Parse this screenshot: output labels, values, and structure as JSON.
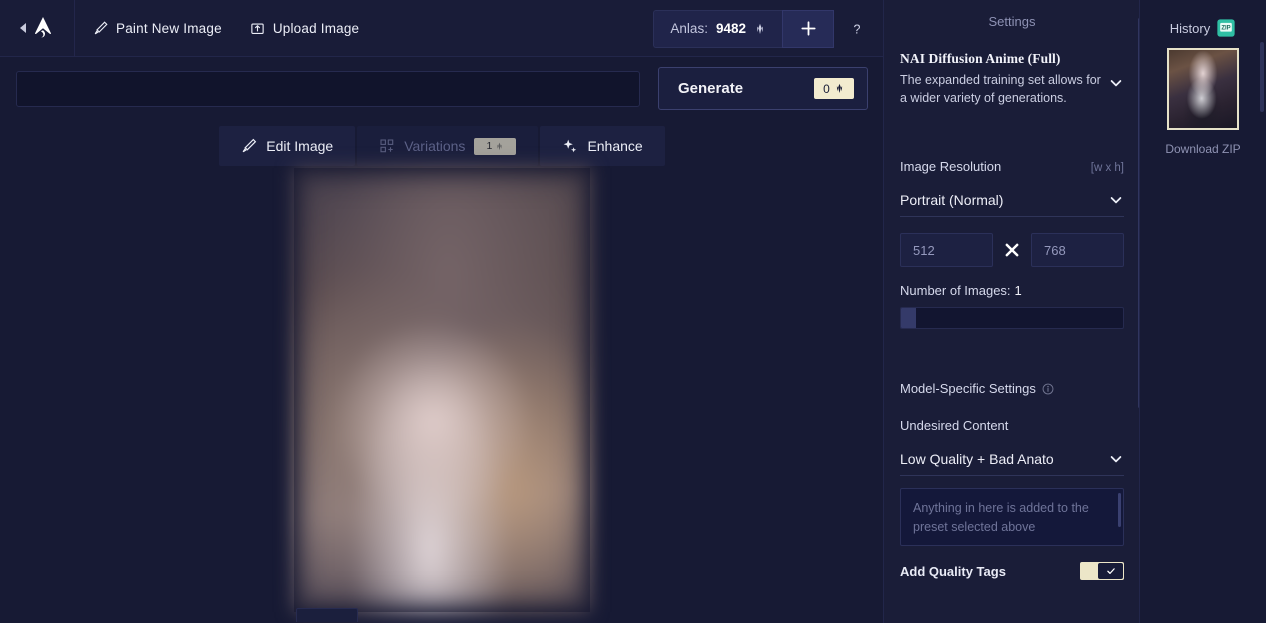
{
  "app": {
    "logo_icon": "novelai-leaf-logo",
    "collapse_icon": "collapse-left-arrow"
  },
  "toolbar": {
    "paint_new_image": "Paint New Image",
    "paint_icon": "paintbrush-icon",
    "upload_image": "Upload Image",
    "upload_icon": "upload-image-icon",
    "anlas_label": "Anlas:",
    "anlas_count": "9482",
    "anlas_icon": "anlas-icon",
    "add_icon": "plus-icon",
    "help_icon": "question-mark-icon"
  },
  "prompt": {
    "value": "",
    "placeholder": ""
  },
  "generate": {
    "label": "Generate",
    "cost": "0",
    "cost_icon": "anlas-icon"
  },
  "actions": [
    {
      "label": "Edit Image",
      "icon": "pencil-icon",
      "disabled": false,
      "badge": null
    },
    {
      "label": "Variations",
      "icon": "variations-grid-icon",
      "disabled": true,
      "badge": "1",
      "badge_icon": "anlas-icon"
    },
    {
      "label": "Enhance",
      "icon": "sparkle-icon",
      "disabled": false,
      "badge": null
    }
  ],
  "canvas": {
    "image_alt": "generated-image"
  },
  "settings": {
    "title": "Settings",
    "model": {
      "name": "NAI Diffusion Anime (Full)",
      "description": "The expanded training set allows for a wider variety of generations.",
      "chevron_icon": "chevron-down-icon"
    },
    "resolution": {
      "label": "Image Resolution",
      "hint": "[w x h]",
      "preset": "Portrait (Normal)",
      "chevron_icon": "chevron-down-icon",
      "width": "512",
      "height": "768",
      "x_icon": "multiply-icon"
    },
    "number_of_images": {
      "label": "Number of Images:",
      "value": "1"
    },
    "model_specific": {
      "label": "Model-Specific Settings",
      "info_icon": "info-circle-icon"
    },
    "undesired_content": {
      "label": "Undesired Content",
      "preset": "Low Quality + Bad Anato",
      "chevron_icon": "chevron-down-icon",
      "textarea_placeholder": "Anything in here is added to the preset selected above",
      "textarea_value": ""
    },
    "quality_tags": {
      "label": "Add Quality Tags",
      "enabled": true,
      "check_icon": "checkmark-icon"
    }
  },
  "history": {
    "title": "History",
    "zip_icon": "zip-file-icon",
    "download_zip": "Download ZIP",
    "thumbnail_alt": "history-thumbnail"
  },
  "colors": {
    "background": "#171a34",
    "panel": "#1a1d38",
    "accent_cream": "#f2ebcf",
    "zip_teal": "#2fbfa4"
  }
}
